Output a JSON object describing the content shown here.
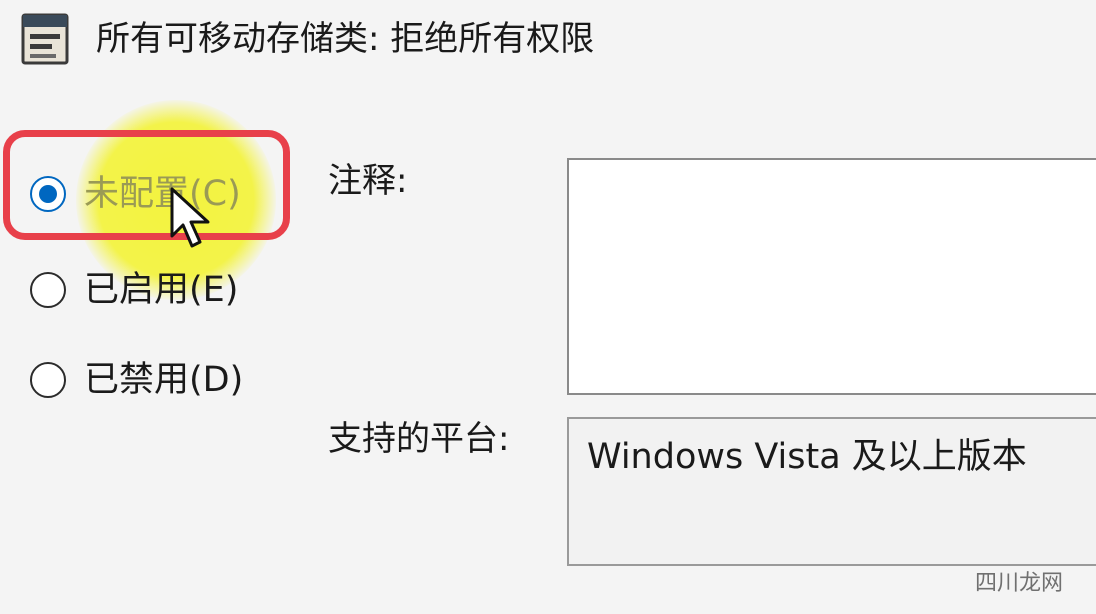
{
  "window": {
    "title": "所有可移动存储类: 拒绝所有权限",
    "icon": "policy-setting-icon"
  },
  "state_options": [
    {
      "label": "未配置(C)",
      "checked": true
    },
    {
      "label": "已启用(E)",
      "checked": false
    },
    {
      "label": "已禁用(D)",
      "checked": false
    }
  ],
  "comment": {
    "label": "注释:",
    "value": ""
  },
  "platform": {
    "label": "支持的平台:",
    "value": "Windows Vista 及以上版本"
  },
  "watermark": "四川龙网",
  "colors": {
    "accent": "#0067c0",
    "highlight": "#f3f337",
    "annotation_frame": "#e8404a"
  }
}
